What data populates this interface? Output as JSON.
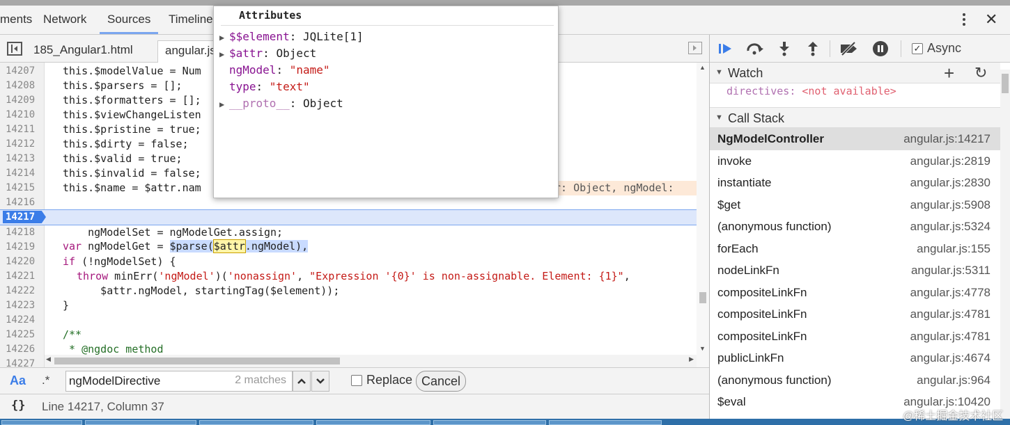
{
  "panel_tabs": [
    {
      "label": "ments"
    },
    {
      "label": "Network"
    },
    {
      "label": "Sources"
    },
    {
      "label": "Timeline"
    }
  ],
  "file_tabs": [
    {
      "label": "185_Angular1.html"
    },
    {
      "label": "angular.js"
    }
  ],
  "editor": {
    "lines": [
      {
        "num": "14207",
        "code": "this.$modelValue = Num"
      },
      {
        "num": "14208",
        "code": "this.$parsers = [];"
      },
      {
        "num": "14209",
        "code": "this.$formatters = [];"
      },
      {
        "num": "14210",
        "code": "this.$viewChangeListen"
      },
      {
        "num": "14211",
        "code": "this.$pristine = true;"
      },
      {
        "num": "14212",
        "code": "this.$dirty = false;"
      },
      {
        "num": "14213",
        "code": "this.$valid = true;"
      },
      {
        "num": "14214",
        "code": "this.$invalid = false;"
      },
      {
        "num": "14215",
        "code": "this.$name = $attr.nam"
      },
      {
        "num": "14216",
        "code": ""
      },
      {
        "num": "14217",
        "code": ""
      },
      {
        "num": "14218",
        "code": "    ngModelSet = ngModelGet.assign;"
      },
      {
        "num": "14219",
        "code": ""
      },
      {
        "num": "14220",
        "code": ""
      },
      {
        "num": "14221",
        "code": ""
      },
      {
        "num": "14222",
        "code": "      $attr.ngModel, startingTag($element));"
      },
      {
        "num": "14223",
        "code": "}"
      },
      {
        "num": "14224",
        "code": ""
      },
      {
        "num": "14225",
        "code": "/**"
      },
      {
        "num": "14226",
        "code": " * @ngdoc method"
      },
      {
        "num": "14227",
        "code": ""
      }
    ],
    "line_14215_value": "r: Object, ngModel:",
    "exec_line": {
      "kw": "var",
      "mid": " ngModelGet = ",
      "parse": "$parse(",
      "attr": "$attr",
      "tail": ".ngModel),"
    },
    "line_14220": {
      "kw": "if",
      "rest": " (!ngModelSet) {"
    },
    "line_14221": {
      "kw": "throw",
      "p1": " minErr(",
      "s1": "'ngModel'",
      "p2": ")(",
      "s2": "'nonassign'",
      "p3": ", ",
      "s3": "\"Expression '{0}' is non-assignable. Element: {1}\"",
      "p4": ","
    }
  },
  "popover": {
    "title": "Attributes",
    "rows": [
      {
        "key": "$$element",
        "value": "JQLite[1]",
        "expandable": "▶",
        "kind": "obj"
      },
      {
        "key": "$attr",
        "value": "Object",
        "expandable": "▶",
        "kind": "obj"
      },
      {
        "key": "ngModel",
        "value": "\"name\"",
        "expandable": "",
        "kind": "str"
      },
      {
        "key": "type",
        "value": "\"text\"",
        "expandable": "",
        "kind": "str"
      },
      {
        "key": "__proto__",
        "value": "Object",
        "expandable": "▶",
        "kind": "proto"
      }
    ]
  },
  "find": {
    "case_label": "Aa",
    "regex_label": ".*",
    "query": "ngModelDirective",
    "matches": "2 matches",
    "replace_label": "Replace",
    "cancel_label": "Cancel"
  },
  "status": {
    "braces": "{}",
    "position": "Line 14217, Column 37"
  },
  "debugger": {
    "async_label": "Async",
    "async_check": "✓",
    "watch_title": "Watch",
    "watch_plus": "+",
    "watch_refresh": "↻",
    "watch_entry": {
      "name": "directives",
      "value": "<not available>"
    },
    "callstack_title": "Call Stack",
    "frames": [
      {
        "fn": "NgModelController",
        "loc": "angular.js:14217"
      },
      {
        "fn": "invoke",
        "loc": "angular.js:2819"
      },
      {
        "fn": "instantiate",
        "loc": "angular.js:2830"
      },
      {
        "fn": "$get",
        "loc": "angular.js:5908"
      },
      {
        "fn": "(anonymous function)",
        "loc": "angular.js:5324"
      },
      {
        "fn": "forEach",
        "loc": "angular.js:155"
      },
      {
        "fn": "nodeLinkFn",
        "loc": "angular.js:5311"
      },
      {
        "fn": "compositeLinkFn",
        "loc": "angular.js:4778"
      },
      {
        "fn": "compositeLinkFn",
        "loc": "angular.js:4781"
      },
      {
        "fn": "compositeLinkFn",
        "loc": "angular.js:4781"
      },
      {
        "fn": "publicLinkFn",
        "loc": "angular.js:4674"
      },
      {
        "fn": "(anonymous function)",
        "loc": "angular.js:964"
      },
      {
        "fn": "$eval",
        "loc": "angular.js:10420"
      }
    ]
  },
  "window": {
    "close": "✕"
  },
  "watermark": "@稀土掘金技术社区",
  "colors": {
    "accent": "#3b7de8",
    "exec_line_bg": "#dde7fb",
    "selected_frame_bg": "#dedede",
    "taskbar": "#2e6fa8"
  },
  "icons": [
    "resume-icon",
    "step-over-icon",
    "step-into-icon",
    "step-out-icon",
    "deactivate-breakpoints-icon",
    "pause-on-exceptions-icon"
  ]
}
